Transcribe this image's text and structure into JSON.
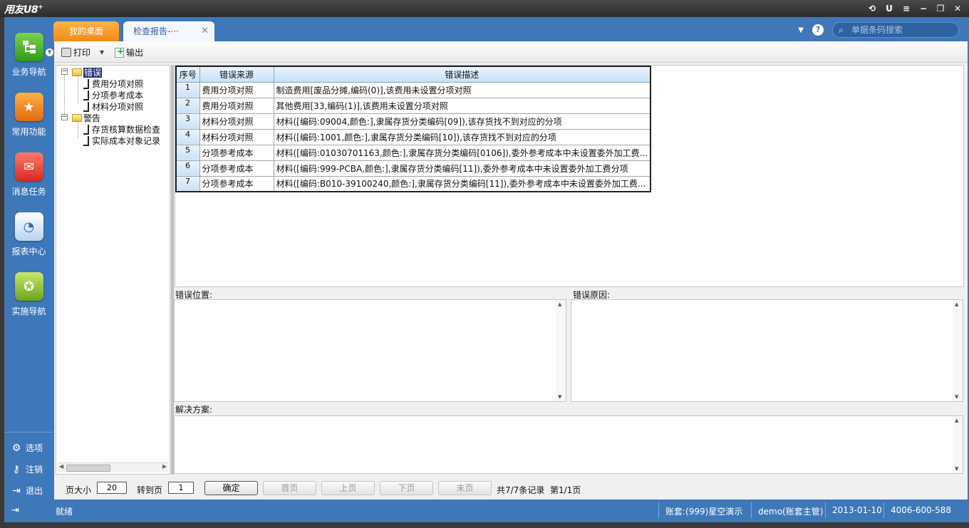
{
  "app": {
    "logo": "用友U8",
    "logo_sup": "+"
  },
  "window_controls": [
    "⟲",
    "U",
    "≡",
    "−",
    "❐",
    "✕"
  ],
  "nav": {
    "items": [
      {
        "label": "业务导航",
        "icon": "business-nav-icon"
      },
      {
        "label": "常用功能",
        "icon": "star-icon"
      },
      {
        "label": "消息任务",
        "icon": "mail-icon"
      },
      {
        "label": "报表中心",
        "icon": "report-icon"
      },
      {
        "label": "实施导航",
        "icon": "compass-icon"
      }
    ],
    "bottom": [
      {
        "label": "选项",
        "icon": "gear-icon"
      },
      {
        "label": "注销",
        "icon": "key-icon"
      },
      {
        "label": "退出",
        "icon": "exit-icon"
      }
    ]
  },
  "tabs": [
    {
      "label": "我的桌面"
    },
    {
      "label": "检查报告-···"
    }
  ],
  "search": {
    "placeholder": "单据条码搜索"
  },
  "toolbar": {
    "print": "打印",
    "export": "输出"
  },
  "tree": {
    "error_root": "错误",
    "error_items": [
      "费用分项对照",
      "分项参考成本",
      "材料分项对照"
    ],
    "warning_root": "警告",
    "warning_items": [
      "存货核算数据检查",
      "实际成本对象记录"
    ]
  },
  "grid": {
    "headers": [
      "序号",
      "错误来源",
      "错误描述"
    ],
    "rows": [
      {
        "idx": "1",
        "source": "费用分项对照",
        "desc": "制造费用[废品分摊,编码(0)],该费用未设置分项对照"
      },
      {
        "idx": "2",
        "source": "费用分项对照",
        "desc": "其他费用[33,编码(1)],该费用未设置分项对照"
      },
      {
        "idx": "3",
        "source": "材料分项对照",
        "desc": "材料([编码:09004,颜色:],隶属存货分类编码[09]),该存货找不到对应的分项"
      },
      {
        "idx": "4",
        "source": "材料分项对照",
        "desc": "材料([编码:1001,颜色:],隶属存货分类编码[10]),该存货找不到对应的分项"
      },
      {
        "idx": "5",
        "source": "分项参考成本",
        "desc": "材料([编码:01030701163,颜色:],隶属存货分类编码[0106]),委外参考成本中未设置委外加工费..."
      },
      {
        "idx": "6",
        "source": "分项参考成本",
        "desc": "材料([编码:999-PCBA,颜色:],隶属存货分类编码[11]),委外参考成本中未设置委外加工费分项"
      },
      {
        "idx": "7",
        "source": "分项参考成本",
        "desc": "材料([编码:B010-39100240,颜色:],隶属存货分类编码[11]),委外参考成本中未设置委外加工费..."
      }
    ]
  },
  "details": {
    "location_label": "错误位置:",
    "reason_label": "错误原因:",
    "solution_label": "解决方案:"
  },
  "pager": {
    "page_size_label": "页大小",
    "page_size": "20",
    "goto_label": "转到页",
    "goto_page": "1",
    "ok": "确定",
    "first": "首页",
    "prev": "上页",
    "next": "下页",
    "last": "末页",
    "summary": "共7/7条记录",
    "page_info": "第1/1页"
  },
  "status": {
    "ready": "就绪",
    "account": "账套:(999)星空演示",
    "user": "demo(账套主管)",
    "date": "2013-01-10",
    "phone": "4006-600-588"
  }
}
